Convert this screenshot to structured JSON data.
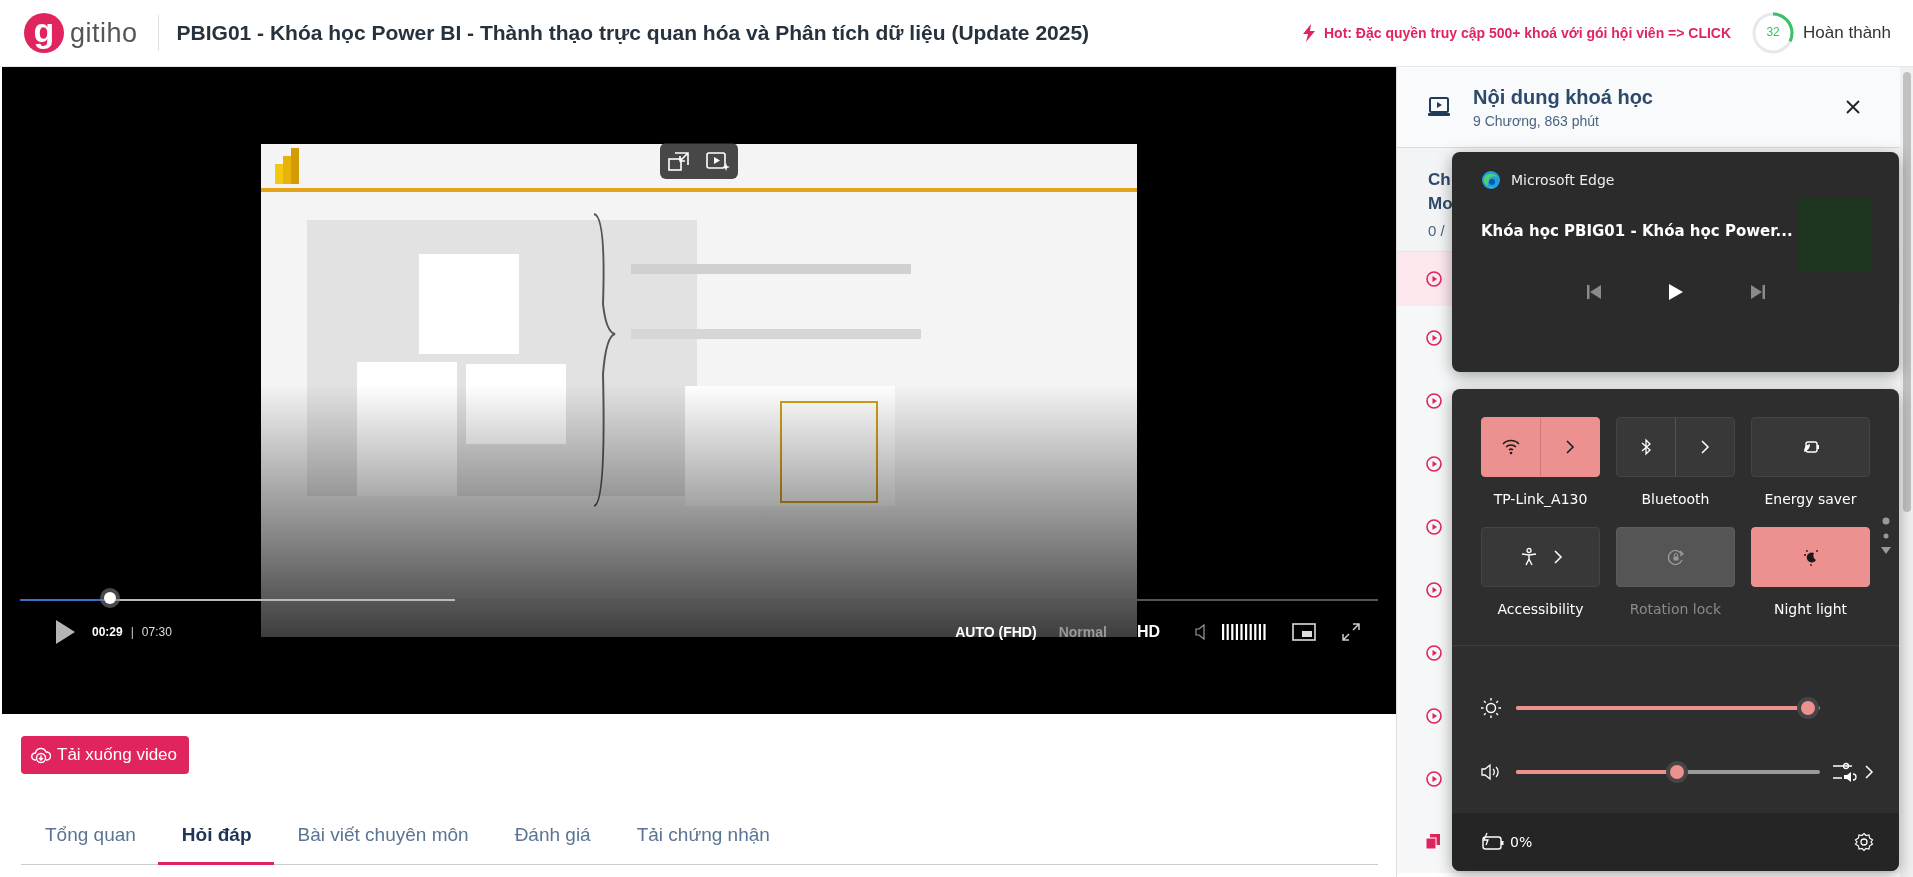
{
  "header": {
    "logo": {
      "mark": "g",
      "name": "gitiho"
    },
    "title": "PBIG01 - Khóa học Power BI - Thành thạo trực quan hóa và Phân tích dữ liệu (Update 2025)",
    "promo": "Hot: Đặc quyền truy cập 500+ khoá với gói hội viên => CLICK",
    "progress": {
      "value": "32",
      "level": 0.32,
      "label": "Hoàn thành"
    }
  },
  "player": {
    "progress": {
      "level": 0.066
    },
    "buffered": {
      "level": 0.32
    },
    "time_current": "00:29",
    "separator": "|",
    "duration": "07:30",
    "quality": "AUTO (FHD)",
    "speed": "Normal",
    "hd": "HD"
  },
  "download_button": "Tải xuống video",
  "tabs": [
    {
      "label": "Tổng quan",
      "selected": false
    },
    {
      "label": "Hỏi đáp",
      "selected": true
    },
    {
      "label": "Bài viết chuyên môn",
      "selected": false
    },
    {
      "label": "Đánh giá",
      "selected": false
    },
    {
      "label": "Tải chứng nhận",
      "selected": false
    }
  ],
  "sidebar": {
    "title": "Nội dung khoá học",
    "subtitle": "9 Chương, 863 phút",
    "chapter": [
      "Ch",
      "Mo",
      "0 /"
    ],
    "lessons": [
      {
        "kind": "video",
        "selected": true
      },
      {
        "kind": "video",
        "selected": false
      },
      {
        "kind": "video",
        "selected": false
      },
      {
        "kind": "video",
        "selected": false
      },
      {
        "kind": "video",
        "selected": false
      },
      {
        "kind": "video",
        "selected": false
      },
      {
        "kind": "video",
        "selected": false
      },
      {
        "kind": "video",
        "selected": false
      },
      {
        "kind": "video",
        "selected": false
      },
      {
        "kind": "document",
        "selected": false
      }
    ]
  },
  "media_flyout": {
    "app": "Microsoft Edge",
    "title": "Khóa học PBIG01 - Khóa học Power..."
  },
  "quick_settings": {
    "tiles": [
      {
        "label": "TP-Link_A130",
        "kind": "split",
        "on": true,
        "disabled": false
      },
      {
        "label": "Bluetooth",
        "kind": "split",
        "on": false,
        "disabled": false
      },
      {
        "label": "Energy saver",
        "kind": "plain",
        "on": false,
        "disabled": false
      },
      {
        "label": "Accessibility",
        "kind": "chevron",
        "on": false,
        "disabled": false
      },
      {
        "label": "Rotation lock",
        "kind": "plain",
        "on": false,
        "disabled": true
      },
      {
        "label": "Night light",
        "kind": "plain",
        "on": true,
        "disabled": false
      }
    ],
    "sliders": [
      {
        "kind": "brightness",
        "level": 0.96
      },
      {
        "kind": "volume",
        "level": 0.53
      }
    ],
    "battery": "0%"
  }
}
